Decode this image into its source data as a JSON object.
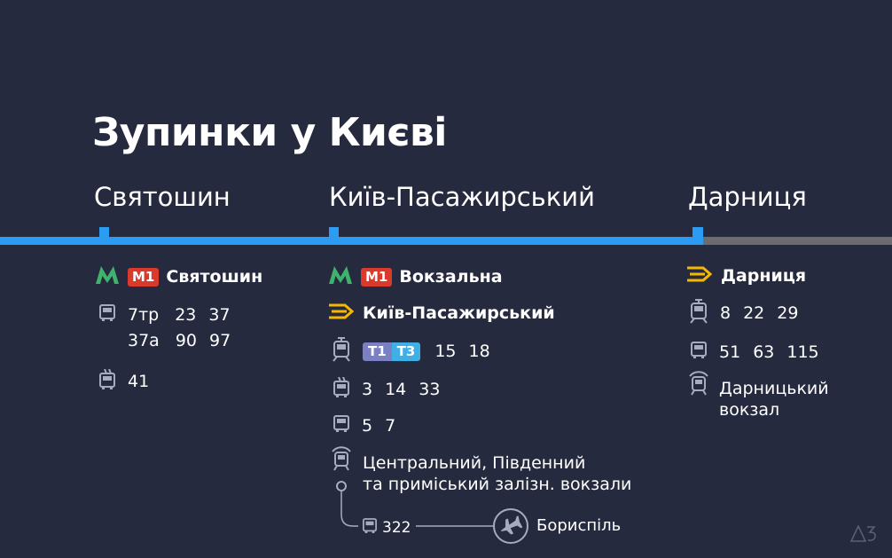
{
  "title": "Зупинки у Києві",
  "stations": {
    "sviatoshyn": {
      "name": "Святошин",
      "metro_line": "M1",
      "metro_station": "Святошин",
      "bus_routes_row1": [
        "7тр",
        "23",
        "37"
      ],
      "bus_routes_row2": [
        "37а",
        "90",
        "97"
      ],
      "trolleybus_routes": [
        "41"
      ]
    },
    "kyiv_pas": {
      "name": "Київ-Пасажирський",
      "metro_line": "M1",
      "metro_station": "Вокзальна",
      "rail_station": "Київ-Пасажирський",
      "tram_badge_1": "T1",
      "tram_badge_2": "T3",
      "tram_routes": [
        "15",
        "18"
      ],
      "trolleybus_routes": [
        "3",
        "14",
        "33"
      ],
      "bus_routes": [
        "5",
        "7"
      ],
      "station_text_line1": "Центральний, Південний",
      "station_text_line2": "та приміський залізн. вокзали",
      "airport_bus": "322",
      "airport": "Бориспіль"
    },
    "darnytsia": {
      "name": "Дарниця",
      "rail_station": "Дарниця",
      "tram_routes": [
        "8",
        "22",
        "29"
      ],
      "bus_routes": [
        "51",
        "63",
        "115"
      ],
      "station_text_line1": "Дарницький",
      "station_text_line2": "вокзал"
    }
  },
  "colors": {
    "background": "#262a3e",
    "line_blue": "#2b9cf2",
    "line_grey": "#6c6c70",
    "metro_green": "#3fb36b",
    "metro_red": "#d93a2b",
    "rail_yellow": "#f5b800",
    "icon_grey": "#a7abbf"
  },
  "icons": [
    "metro-icon",
    "bus-icon",
    "trolleybus-icon",
    "tram-icon",
    "rail-icon",
    "train-station-icon",
    "airplane-icon",
    "logo-icon"
  ]
}
